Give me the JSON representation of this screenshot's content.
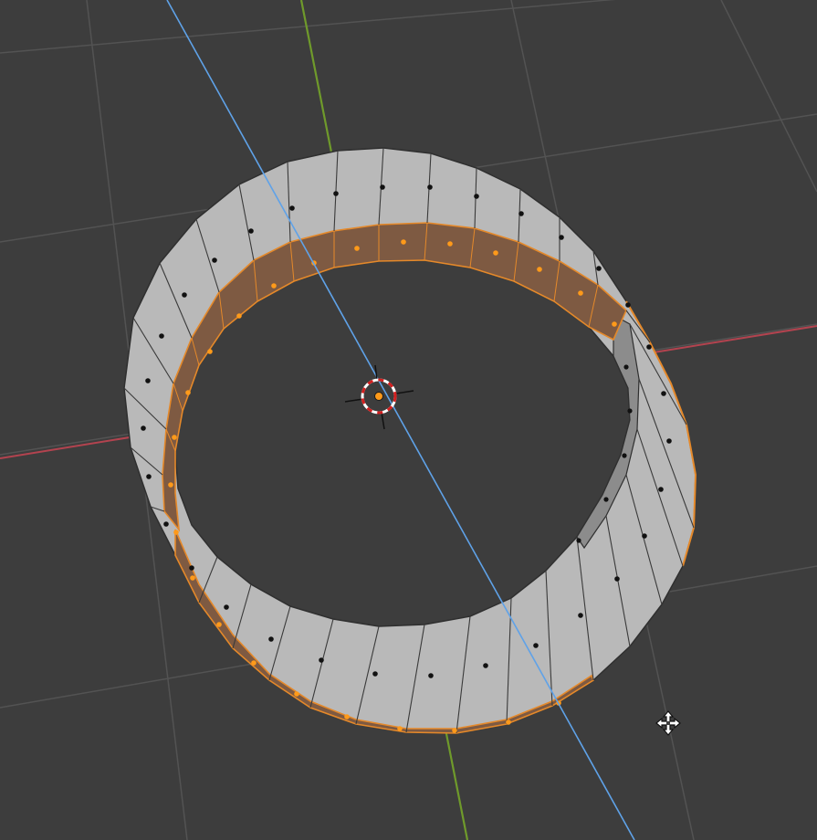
{
  "viewport": {
    "mode": "edit-mode",
    "select_mode": "face",
    "background": "#3d3d3d"
  },
  "colors": {
    "grid": "#535353",
    "x_axis": "#b3434f",
    "y_axis": "#6f9a2b",
    "z_axis": "#5fa2e8",
    "mesh_face": "#b9b9b9",
    "mesh_face_dark": "#8c8c8c",
    "mesh_edge": "#3a3a3a",
    "selected_face": "#7e5a42",
    "selected_edge": "#e5892a",
    "selected_dot": "#ff9a1a",
    "face_dot": "#111111",
    "origin": "#ff9a1a",
    "cursor_red": "#d21f1f",
    "cursor_white": "#ffffff"
  },
  "mesh": {
    "object": "cylinder",
    "segments": 32,
    "selected_faces": "outer-top-ring"
  },
  "icons": {
    "cursor": "3d-cursor-icon",
    "origin": "object-origin-icon",
    "move": "move-cursor-icon"
  }
}
